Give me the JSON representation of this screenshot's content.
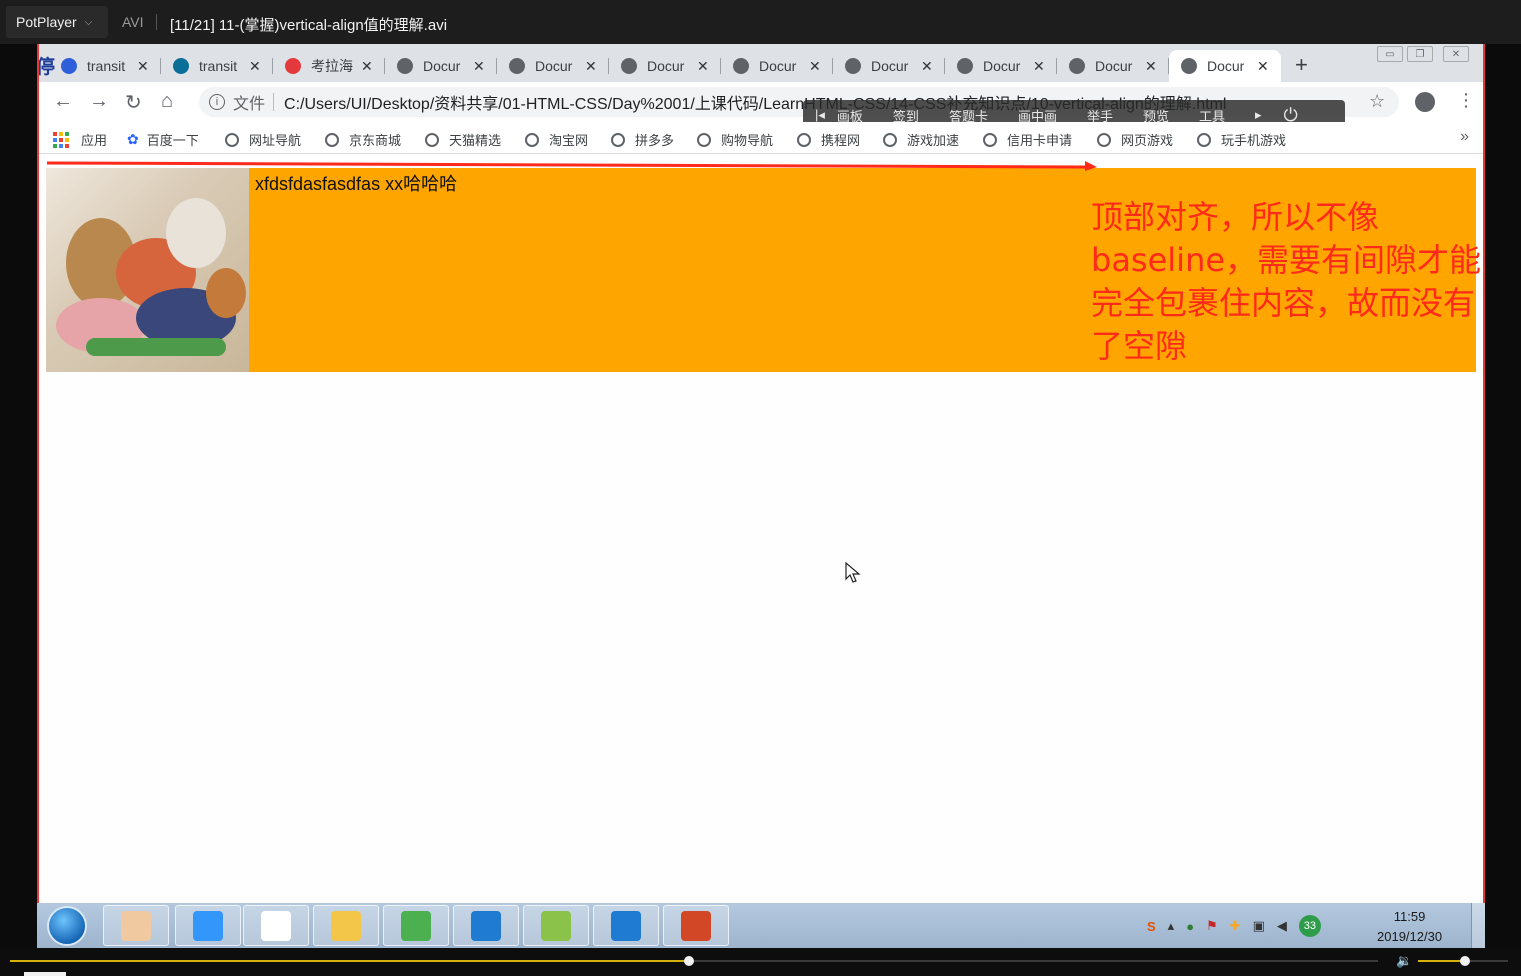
{
  "player": {
    "brand": "PotPlayer",
    "format": "AVI",
    "file_title": "[11/21] 11-(掌握)vertical-align值的理解.avi",
    "status": "暂停",
    "progress_percent": 49.6,
    "volume_percent": 52
  },
  "browser": {
    "tabs": [
      {
        "title": "transit",
        "icon": "baidu-paw-icon",
        "color": "#2f5fd8"
      },
      {
        "title": "transit",
        "icon": "flag-icon",
        "color": "#0b6e99"
      },
      {
        "title": "考拉海",
        "icon": "kaola-icon",
        "color": "#e4393c"
      },
      {
        "title": "Docur",
        "icon": "globe-icon",
        "color": "#5f6368"
      },
      {
        "title": "Docur",
        "icon": "globe-icon",
        "color": "#5f6368"
      },
      {
        "title": "Docur",
        "icon": "globe-icon",
        "color": "#5f6368"
      },
      {
        "title": "Docur",
        "icon": "globe-icon",
        "color": "#5f6368"
      },
      {
        "title": "Docur",
        "icon": "globe-icon",
        "color": "#5f6368"
      },
      {
        "title": "Docur",
        "icon": "globe-icon",
        "color": "#5f6368"
      },
      {
        "title": "Docur",
        "icon": "globe-icon",
        "color": "#5f6368"
      },
      {
        "title": "Docur",
        "icon": "globe-icon",
        "color": "#5f6368",
        "active": true
      }
    ],
    "scheme_label": "文件",
    "url": "C:/Users/UI/Desktop/资料共享/01-HTML-CSS/Day%2001/上课代码/LearnHTML-CSS/14-CSS补充知识点/10-vertical-align的理解.html",
    "floating_toolbar": [
      "画板",
      "签到",
      "答题卡",
      "画中画",
      "举手",
      "预览",
      "工具"
    ],
    "bookmarks": [
      {
        "label": "应用",
        "icon": "apps-grid-icon"
      },
      {
        "label": "百度一下",
        "icon": "baidu-paw-icon"
      },
      {
        "label": "网址导航",
        "icon": "globe-icon"
      },
      {
        "label": "京东商城",
        "icon": "globe-icon"
      },
      {
        "label": "天猫精选",
        "icon": "globe-icon"
      },
      {
        "label": "淘宝网",
        "icon": "globe-icon"
      },
      {
        "label": "拼多多",
        "icon": "globe-icon"
      },
      {
        "label": "购物导航",
        "icon": "globe-icon"
      },
      {
        "label": "携程网",
        "icon": "globe-icon"
      },
      {
        "label": "游戏加速",
        "icon": "globe-icon"
      },
      {
        "label": "信用卡申请",
        "icon": "globe-icon"
      },
      {
        "label": "网页游戏",
        "icon": "globe-icon"
      },
      {
        "label": "玩手机游戏",
        "icon": "globe-icon"
      }
    ]
  },
  "page": {
    "inline_text": "xfdsfdasfasdfas xx哈哈哈",
    "box_color": "#ffa500",
    "annotation_lines": [
      "顶部对齐，所以不像",
      "baseline，需要有间隙才能",
      "完全包裹住内容，故而没有",
      "了空隙"
    ],
    "annotation_color": "#ff2a1a"
  },
  "taskbar": {
    "apps": [
      {
        "name": "avatar-app",
        "color": "#f0c9a0"
      },
      {
        "name": "dingtalk-app",
        "color": "#3296fa"
      },
      {
        "name": "typora-app",
        "color": "#ffffff"
      },
      {
        "name": "file-explorer-app",
        "color": "#f3c64a"
      },
      {
        "name": "chrome-app",
        "color": "#4caf50"
      },
      {
        "name": "vscode-app",
        "color": "#1f7ad1"
      },
      {
        "name": "notepad-app",
        "color": "#8bc34a"
      },
      {
        "name": "vscode-app-2",
        "color": "#1f7ad1"
      },
      {
        "name": "powerpoint-app",
        "color": "#d24726"
      }
    ],
    "tray_badge": "33",
    "time": "11:59",
    "date": "2019/12/30"
  }
}
